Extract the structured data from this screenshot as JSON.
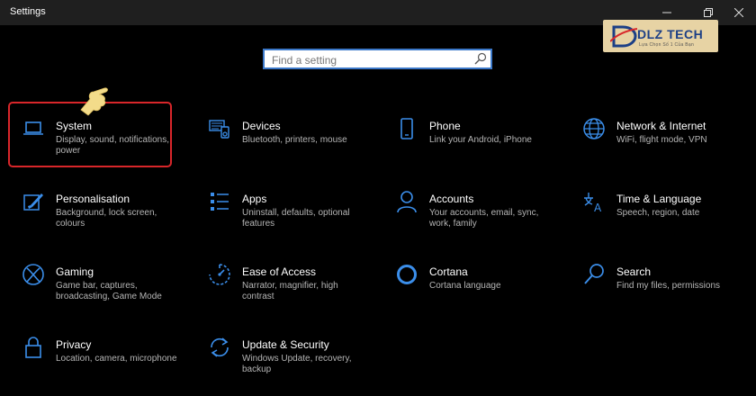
{
  "window": {
    "title": "Settings",
    "controls": [
      "minimize",
      "restore",
      "close"
    ]
  },
  "search": {
    "placeholder": "Find a setting",
    "value": ""
  },
  "logo": {
    "brand": "DLZ TECH",
    "tagline": "Lựa Chọn Số 1 Của Bạn"
  },
  "colors": {
    "accent": "#3b8eea",
    "highlight_border": "#d8262a",
    "background": "#000000"
  },
  "tiles": [
    {
      "name": "System",
      "desc": "Display, sound, notifications, power",
      "icon": "laptop-icon"
    },
    {
      "name": "Devices",
      "desc": "Bluetooth, printers, mouse",
      "icon": "devices-icon"
    },
    {
      "name": "Phone",
      "desc": "Link your Android, iPhone",
      "icon": "phone-icon"
    },
    {
      "name": "Network & Internet",
      "desc": "WiFi, flight mode, VPN",
      "icon": "globe-icon"
    },
    {
      "name": "Personalisation",
      "desc": "Background, lock screen, colours",
      "icon": "paint-icon"
    },
    {
      "name": "Apps",
      "desc": "Uninstall, defaults, optional features",
      "icon": "apps-list-icon"
    },
    {
      "name": "Accounts",
      "desc": "Your accounts, email, sync, work, family",
      "icon": "person-icon"
    },
    {
      "name": "Time & Language",
      "desc": "Speech, region, date",
      "icon": "time-language-icon"
    },
    {
      "name": "Gaming",
      "desc": "Game bar, captures, broadcasting, Game Mode",
      "icon": "xbox-icon"
    },
    {
      "name": "Ease of Access",
      "desc": "Narrator, magnifier, high contrast",
      "icon": "ease-of-access-icon"
    },
    {
      "name": "Cortana",
      "desc": "Cortana language",
      "icon": "cortana-icon"
    },
    {
      "name": "Search",
      "desc": "Find my files, permissions",
      "icon": "search-icon"
    },
    {
      "name": "Privacy",
      "desc": "Location, camera, microphone",
      "icon": "lock-icon"
    },
    {
      "name": "Update & Security",
      "desc": "Windows Update, recovery, backup",
      "icon": "update-icon"
    }
  ]
}
